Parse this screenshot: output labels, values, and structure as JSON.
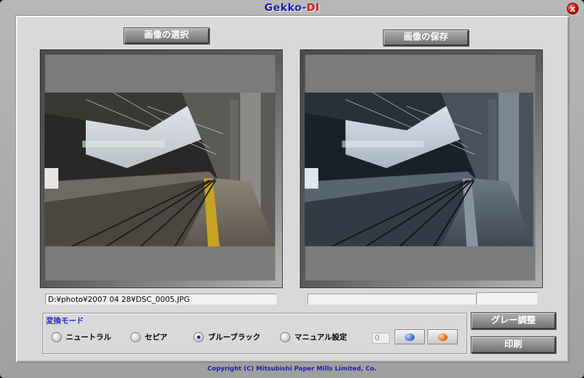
{
  "window": {
    "title_main": "Gekko-",
    "title_accent": "DI",
    "close_glyph": "x",
    "copyright": "Copyright (C) Mitsubishi Paper Mills Limited, Co."
  },
  "toolbar": {
    "select_image_label": "画像の選択",
    "save_image_label": "画像の保存"
  },
  "images": {
    "source_path": "D:¥photo¥2007 04 28¥DSC_0005.JPG",
    "output_path": ""
  },
  "mode": {
    "label": "変換モード",
    "options": [
      {
        "label": "ニュートラル",
        "selected": false
      },
      {
        "label": "セピア",
        "selected": false
      },
      {
        "label": "ブルーブラック",
        "selected": true
      },
      {
        "label": "マニュアル設定",
        "selected": false
      }
    ],
    "manual_value": "0"
  },
  "actions": {
    "gray_adjust_label": "グレー調整",
    "print_label": "印刷"
  },
  "colors": {
    "title_blue": "#1a1aa8",
    "title_red": "#d81818",
    "mode_label_blue": "#2525c8",
    "blue_ball": "#3d6fd0",
    "orange_ball": "#e07418"
  },
  "icons": [
    "close-icon",
    "blue-ball-icon",
    "orange-ball-icon"
  ]
}
